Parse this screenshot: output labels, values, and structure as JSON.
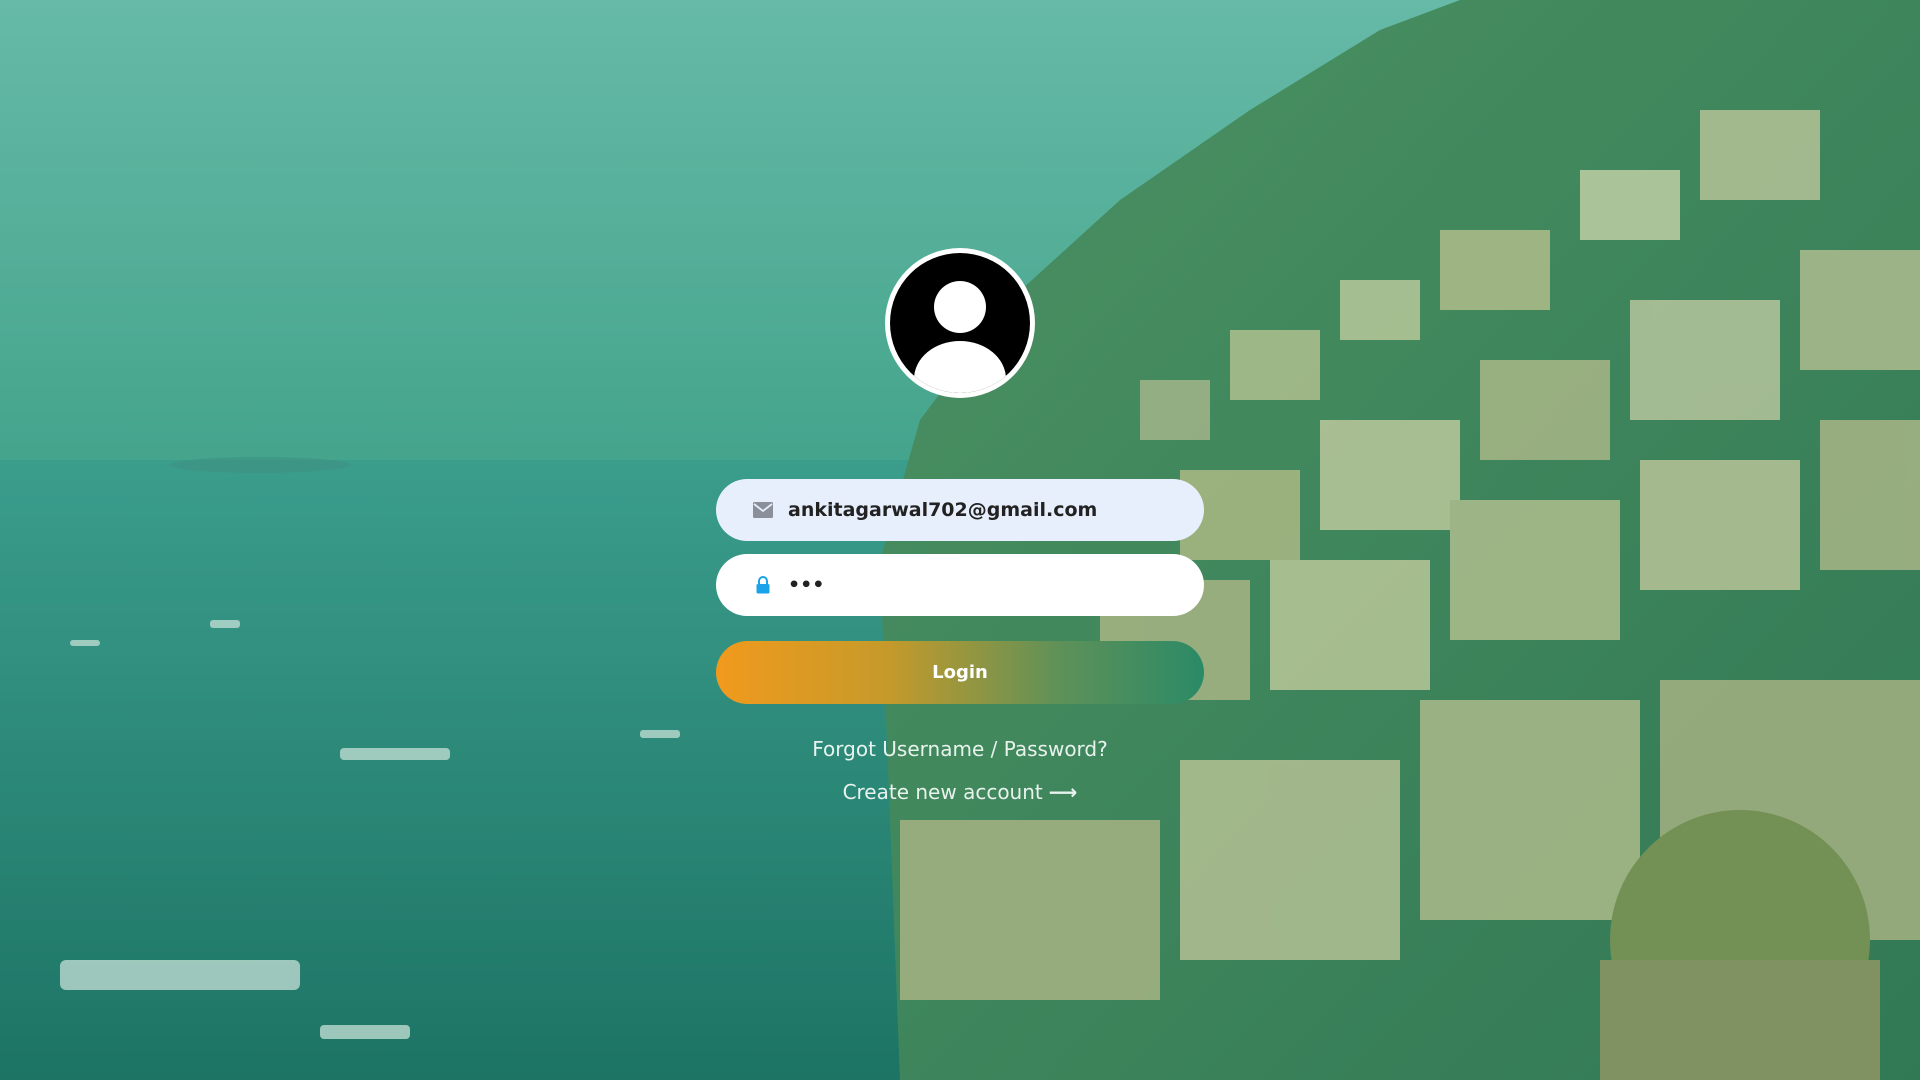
{
  "form": {
    "email_value": "ankitagarwal702@gmail.com",
    "password_value": "•••",
    "login_label": "Login",
    "forgot_label": "Forgot Username / Password?",
    "create_label": "Create new account",
    "create_arrow": "⟶"
  },
  "icons": {
    "avatar": "user-avatar-icon",
    "email": "envelope-icon",
    "password": "lock-icon",
    "arrow": "arrow-right-icon"
  },
  "colors": {
    "login_gradient_start": "#f19a1d",
    "login_gradient_end": "#2b8a67",
    "lock_icon": "#1aa3e8",
    "email_icon": "#8a8f99",
    "email_field_bg": "#e8effc",
    "password_field_bg": "#ffffff"
  }
}
